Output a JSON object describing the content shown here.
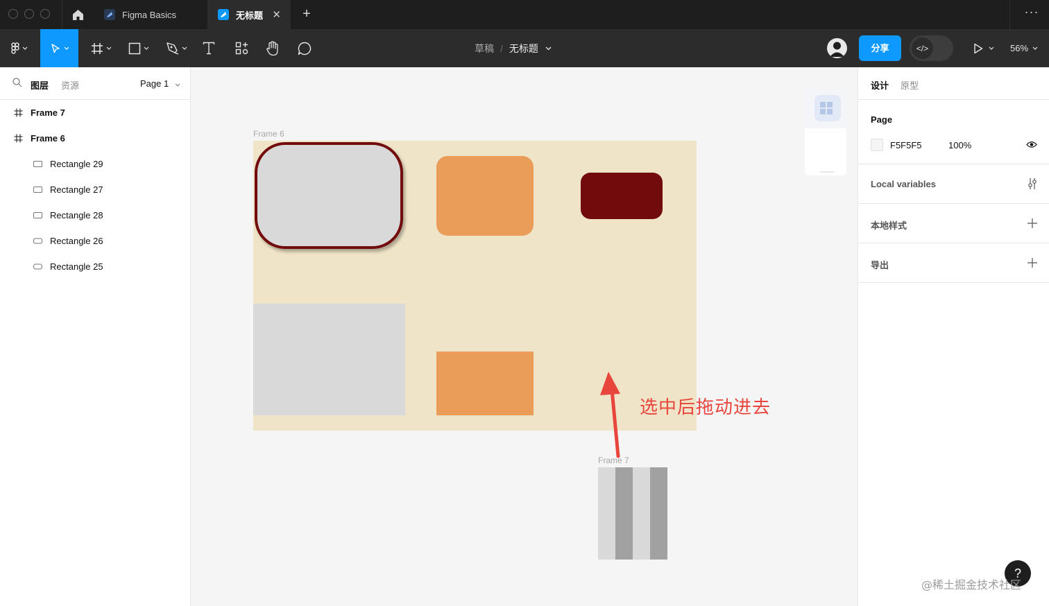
{
  "titlebar": {
    "tabs": [
      {
        "label": "Figma Basics",
        "active": false
      },
      {
        "label": "无标题",
        "active": true
      }
    ],
    "close_symbol": "✕",
    "new_tab_symbol": "+",
    "more_symbol": "···"
  },
  "toolbar": {
    "tools": [
      "figma-menu",
      "move",
      "frame",
      "rectangle",
      "pen",
      "text",
      "resources",
      "hand",
      "comment"
    ],
    "active_tool": "move",
    "breadcrumb": {
      "draft": "草稿",
      "separator": "/",
      "file": "无标题"
    },
    "share_label": "分享",
    "dev_mode_symbol": "</>",
    "zoom": "56%",
    "accent_color": "#0d99ff"
  },
  "left_panel": {
    "tabs": {
      "layers": "图层",
      "assets": "资源"
    },
    "page_selector": "Page 1",
    "layers": [
      {
        "name": "Frame 7",
        "type": "frame"
      },
      {
        "name": "Frame 6",
        "type": "frame"
      },
      {
        "name": "Rectangle 29",
        "type": "rectangle"
      },
      {
        "name": "Rectangle 27",
        "type": "rectangle"
      },
      {
        "name": "Rectangle 28",
        "type": "rectangle"
      },
      {
        "name": "Rectangle 26",
        "type": "rectangle"
      },
      {
        "name": "Rectangle 25",
        "type": "rectangle"
      }
    ]
  },
  "canvas": {
    "frame6_label": "Frame 6",
    "frame7_label": "Frame 7",
    "frame6_color": "#f0e4c8",
    "annotation": "选中后拖动进去",
    "annotation_color": "#e8453c",
    "colors": {
      "gray": "#d9d9d9",
      "orange": "#e99d59",
      "dark_red": "#720b0b",
      "stripe_dark": "#a1a1a1"
    }
  },
  "right_panel": {
    "tabs": {
      "design": "设计",
      "prototype": "原型"
    },
    "page_section": {
      "title": "Page",
      "color_hex": "F5F5F5",
      "opacity": "100%"
    },
    "local_variables": "Local variables",
    "local_styles": "本地样式",
    "export": "导出"
  },
  "help_symbol": "?",
  "watermark": "@稀土掘金技术社区"
}
